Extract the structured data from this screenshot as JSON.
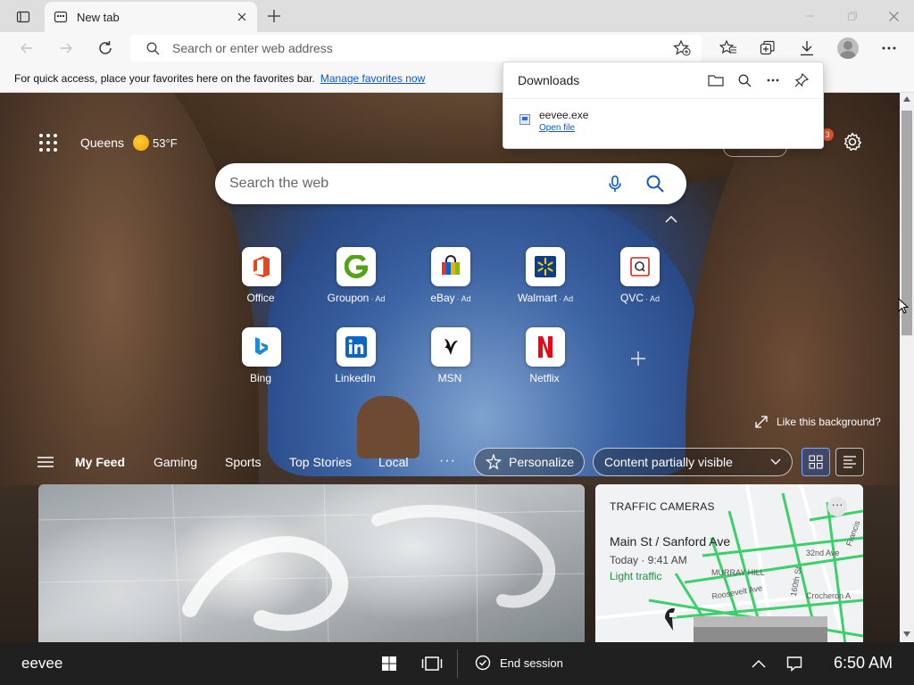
{
  "browser": {
    "tab": {
      "title": "New tab"
    },
    "address_bar": {
      "placeholder": "Search or enter web address"
    },
    "favorites_hint": {
      "text": "For quick access, place your favorites here on the favorites bar.",
      "link": "Manage favorites now"
    }
  },
  "downloads": {
    "title": "Downloads",
    "items": [
      {
        "name": "eevee.exe",
        "action": "Open file"
      }
    ]
  },
  "newtab": {
    "location": "Queens",
    "temperature": "53°F",
    "notification_count": "3",
    "search": {
      "placeholder": "Search the web"
    },
    "quick_links": [
      {
        "label": "Office",
        "ad": ""
      },
      {
        "label": "Groupon",
        "ad": "· Ad"
      },
      {
        "label": "eBay",
        "ad": "· Ad"
      },
      {
        "label": "Walmart",
        "ad": "· Ad"
      },
      {
        "label": "QVC",
        "ad": "· Ad"
      },
      {
        "label": "Bing",
        "ad": ""
      },
      {
        "label": "LinkedIn",
        "ad": ""
      },
      {
        "label": "MSN",
        "ad": ""
      },
      {
        "label": "Netflix",
        "ad": ""
      }
    ],
    "background_prompt": "Like this background?",
    "feed": {
      "tabs": [
        "My Feed",
        "Gaming",
        "Sports",
        "Top Stories",
        "Local"
      ],
      "more": "···",
      "personalize": "Personalize",
      "visibility": "Content partially visible"
    },
    "traffic_card": {
      "label": "TRAFFIC CAMERAS",
      "more": "···",
      "title": "Main St / Sanford Ave",
      "time": "Today · 9:41 AM",
      "status": "Light traffic",
      "map_labels": [
        "MURRAY HILL",
        "32nd Ave",
        "Roosevelt Ave",
        "160th St",
        "Crocheron A",
        "Francis"
      ]
    }
  },
  "system_bar": {
    "session_name": "eevee",
    "end_session": "End session",
    "clock": "6:50 AM"
  },
  "colors": {
    "accent": "#0b57d0",
    "traffic_green": "#1e8e3e",
    "system_bar": "#202020",
    "title_bar": "#dedede"
  }
}
